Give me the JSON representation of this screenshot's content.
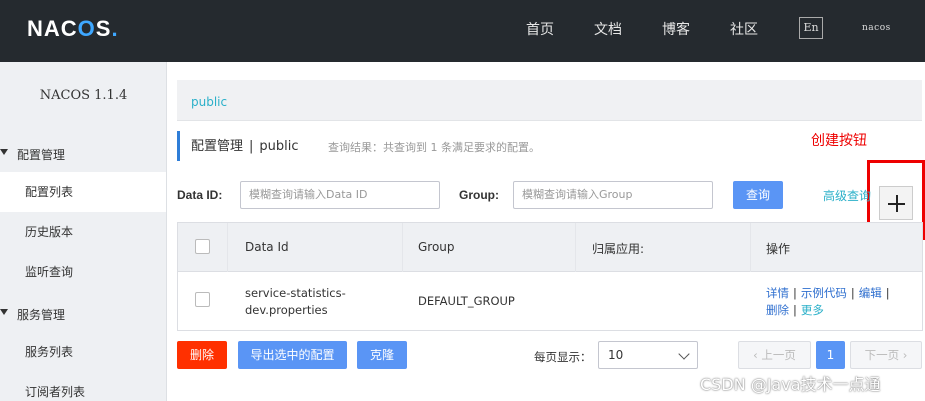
{
  "app": {
    "logo_prefix": "NAC",
    "logo_o": "O",
    "logo_suffix": "S",
    "logo_dot": "."
  },
  "topnav": {
    "items": [
      "首页",
      "文档",
      "博客",
      "社区"
    ],
    "lang": "En",
    "user": "nacos"
  },
  "sidebar": {
    "version": "NACOS 1.1.4",
    "groups": [
      {
        "label": "配置管理",
        "items": [
          "配置列表",
          "历史版本",
          "监听查询"
        ]
      },
      {
        "label": "服务管理",
        "items": [
          "服务列表",
          "订阅者列表"
        ]
      }
    ],
    "active_item": "配置列表"
  },
  "breadcrumb": {
    "namespace": "public"
  },
  "page": {
    "title": "配置管理",
    "separator": "|",
    "namespace": "public",
    "result_tip": "查询结果：共查询到 1 条满足要求的配置。"
  },
  "annotation": {
    "label": "创建按钮"
  },
  "search": {
    "dataid_label": "Data ID:",
    "dataid_placeholder": "模糊查询请输入Data ID",
    "group_label": "Group:",
    "group_placeholder": "模糊查询请输入Group",
    "query_button": "查询",
    "advanced_link": "高级查询"
  },
  "table": {
    "columns": [
      "Data Id",
      "Group",
      "归属应用:",
      "操作"
    ],
    "rows": [
      {
        "data_id_line1": "service-statistics-",
        "data_id_line2": "dev.properties",
        "group": "DEFAULT_GROUP",
        "app": "",
        "ops": [
          "详情",
          "示例代码",
          "编辑",
          "删除",
          "更多"
        ]
      }
    ]
  },
  "footer": {
    "delete_button": "删除",
    "export_button": "导出选中的配置",
    "clone_button": "克隆",
    "per_page_label": "每页显示：",
    "per_page_value": "10",
    "prev_label": "上一页",
    "current_page": "1",
    "next_label": "下一页"
  },
  "watermark": "CSDN @Java技术一点通",
  "colors": {
    "topbar": "#252a2f",
    "accent_blue": "#5a95f5",
    "danger": "#ff3000",
    "link_teal": "#2bb0c9",
    "annotation_red": "#e00000"
  }
}
